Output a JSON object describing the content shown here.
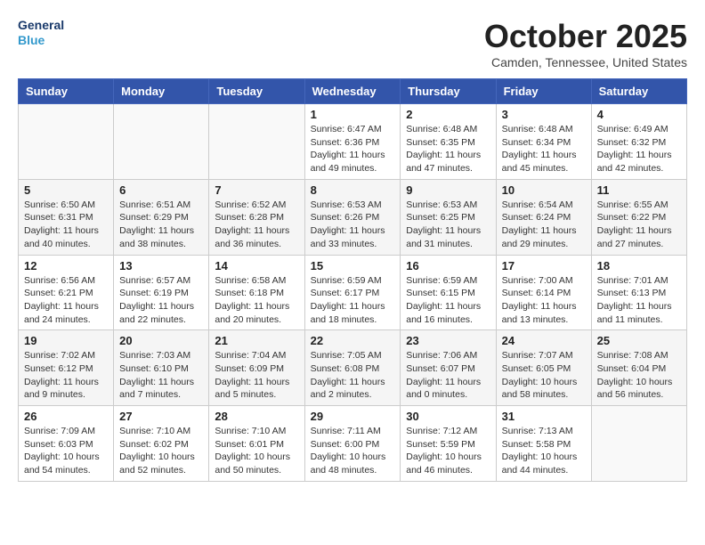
{
  "header": {
    "logo_line1": "General",
    "logo_line2": "Blue",
    "month": "October 2025",
    "location": "Camden, Tennessee, United States"
  },
  "weekdays": [
    "Sunday",
    "Monday",
    "Tuesday",
    "Wednesday",
    "Thursday",
    "Friday",
    "Saturday"
  ],
  "weeks": [
    [
      {
        "day": "",
        "info": ""
      },
      {
        "day": "",
        "info": ""
      },
      {
        "day": "",
        "info": ""
      },
      {
        "day": "1",
        "info": "Sunrise: 6:47 AM\nSunset: 6:36 PM\nDaylight: 11 hours and 49 minutes."
      },
      {
        "day": "2",
        "info": "Sunrise: 6:48 AM\nSunset: 6:35 PM\nDaylight: 11 hours and 47 minutes."
      },
      {
        "day": "3",
        "info": "Sunrise: 6:48 AM\nSunset: 6:34 PM\nDaylight: 11 hours and 45 minutes."
      },
      {
        "day": "4",
        "info": "Sunrise: 6:49 AM\nSunset: 6:32 PM\nDaylight: 11 hours and 42 minutes."
      }
    ],
    [
      {
        "day": "5",
        "info": "Sunrise: 6:50 AM\nSunset: 6:31 PM\nDaylight: 11 hours and 40 minutes."
      },
      {
        "day": "6",
        "info": "Sunrise: 6:51 AM\nSunset: 6:29 PM\nDaylight: 11 hours and 38 minutes."
      },
      {
        "day": "7",
        "info": "Sunrise: 6:52 AM\nSunset: 6:28 PM\nDaylight: 11 hours and 36 minutes."
      },
      {
        "day": "8",
        "info": "Sunrise: 6:53 AM\nSunset: 6:26 PM\nDaylight: 11 hours and 33 minutes."
      },
      {
        "day": "9",
        "info": "Sunrise: 6:53 AM\nSunset: 6:25 PM\nDaylight: 11 hours and 31 minutes."
      },
      {
        "day": "10",
        "info": "Sunrise: 6:54 AM\nSunset: 6:24 PM\nDaylight: 11 hours and 29 minutes."
      },
      {
        "day": "11",
        "info": "Sunrise: 6:55 AM\nSunset: 6:22 PM\nDaylight: 11 hours and 27 minutes."
      }
    ],
    [
      {
        "day": "12",
        "info": "Sunrise: 6:56 AM\nSunset: 6:21 PM\nDaylight: 11 hours and 24 minutes."
      },
      {
        "day": "13",
        "info": "Sunrise: 6:57 AM\nSunset: 6:19 PM\nDaylight: 11 hours and 22 minutes."
      },
      {
        "day": "14",
        "info": "Sunrise: 6:58 AM\nSunset: 6:18 PM\nDaylight: 11 hours and 20 minutes."
      },
      {
        "day": "15",
        "info": "Sunrise: 6:59 AM\nSunset: 6:17 PM\nDaylight: 11 hours and 18 minutes."
      },
      {
        "day": "16",
        "info": "Sunrise: 6:59 AM\nSunset: 6:15 PM\nDaylight: 11 hours and 16 minutes."
      },
      {
        "day": "17",
        "info": "Sunrise: 7:00 AM\nSunset: 6:14 PM\nDaylight: 11 hours and 13 minutes."
      },
      {
        "day": "18",
        "info": "Sunrise: 7:01 AM\nSunset: 6:13 PM\nDaylight: 11 hours and 11 minutes."
      }
    ],
    [
      {
        "day": "19",
        "info": "Sunrise: 7:02 AM\nSunset: 6:12 PM\nDaylight: 11 hours and 9 minutes."
      },
      {
        "day": "20",
        "info": "Sunrise: 7:03 AM\nSunset: 6:10 PM\nDaylight: 11 hours and 7 minutes."
      },
      {
        "day": "21",
        "info": "Sunrise: 7:04 AM\nSunset: 6:09 PM\nDaylight: 11 hours and 5 minutes."
      },
      {
        "day": "22",
        "info": "Sunrise: 7:05 AM\nSunset: 6:08 PM\nDaylight: 11 hours and 2 minutes."
      },
      {
        "day": "23",
        "info": "Sunrise: 7:06 AM\nSunset: 6:07 PM\nDaylight: 11 hours and 0 minutes."
      },
      {
        "day": "24",
        "info": "Sunrise: 7:07 AM\nSunset: 6:05 PM\nDaylight: 10 hours and 58 minutes."
      },
      {
        "day": "25",
        "info": "Sunrise: 7:08 AM\nSunset: 6:04 PM\nDaylight: 10 hours and 56 minutes."
      }
    ],
    [
      {
        "day": "26",
        "info": "Sunrise: 7:09 AM\nSunset: 6:03 PM\nDaylight: 10 hours and 54 minutes."
      },
      {
        "day": "27",
        "info": "Sunrise: 7:10 AM\nSunset: 6:02 PM\nDaylight: 10 hours and 52 minutes."
      },
      {
        "day": "28",
        "info": "Sunrise: 7:10 AM\nSunset: 6:01 PM\nDaylight: 10 hours and 50 minutes."
      },
      {
        "day": "29",
        "info": "Sunrise: 7:11 AM\nSunset: 6:00 PM\nDaylight: 10 hours and 48 minutes."
      },
      {
        "day": "30",
        "info": "Sunrise: 7:12 AM\nSunset: 5:59 PM\nDaylight: 10 hours and 46 minutes."
      },
      {
        "day": "31",
        "info": "Sunrise: 7:13 AM\nSunset: 5:58 PM\nDaylight: 10 hours and 44 minutes."
      },
      {
        "day": "",
        "info": ""
      }
    ]
  ]
}
